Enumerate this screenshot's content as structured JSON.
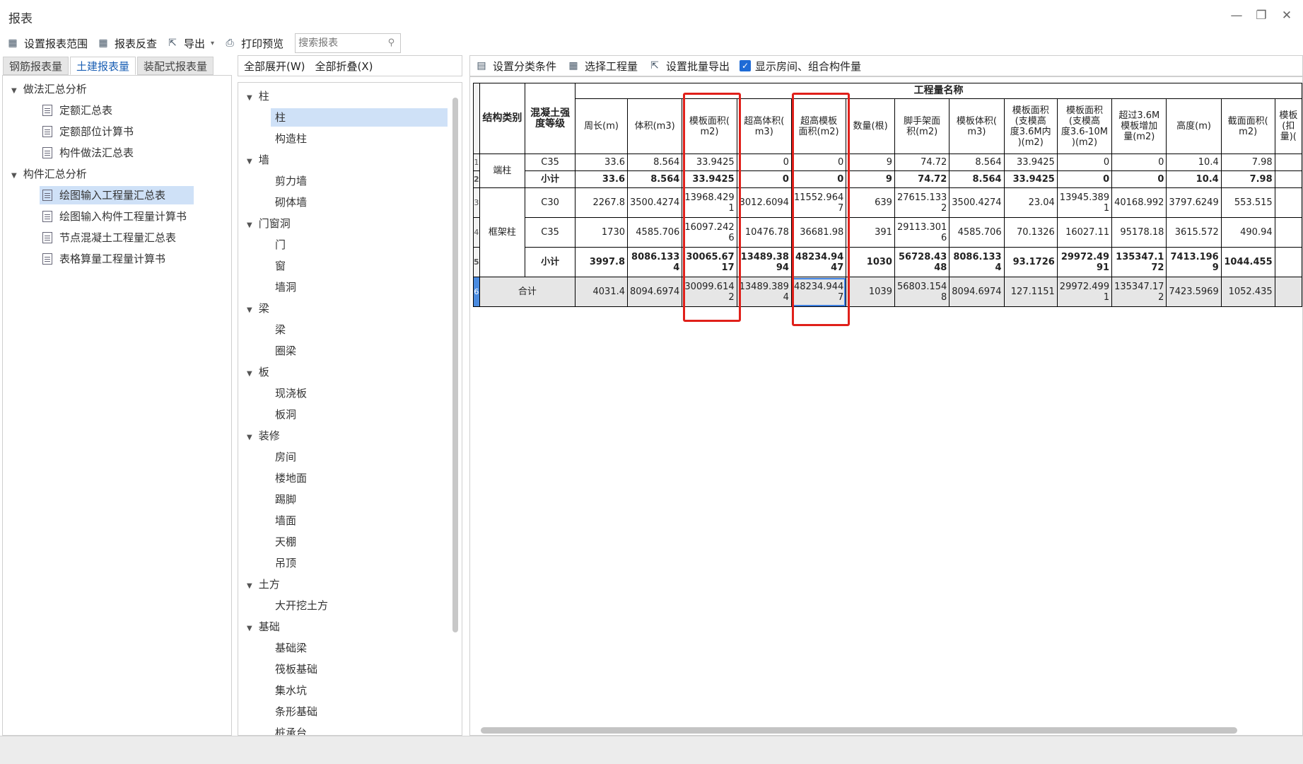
{
  "window": {
    "title": "报表"
  },
  "toolbar": {
    "set_range": "设置报表范围",
    "review": "报表反查",
    "export": "导出",
    "print_preview": "打印预览",
    "search_placeholder": "搜索报表"
  },
  "tabs": [
    "钢筋报表量",
    "土建报表量",
    "装配式报表量"
  ],
  "left_tree": {
    "group1": "做法汇总分析",
    "group1_items": [
      "定额汇总表",
      "定额部位计算书",
      "构件做法汇总表"
    ],
    "group2": "构件汇总分析",
    "group2_items": [
      "绘图输入工程量汇总表",
      "绘图输入构件工程量计算书",
      "节点混凝土工程量汇总表",
      "表格算量工程量计算书"
    ]
  },
  "middle": {
    "expand_all": "全部展开(W)",
    "collapse_all": "全部折叠(X)",
    "categories": [
      {
        "name": "柱",
        "items": [
          "柱",
          "构造柱"
        ]
      },
      {
        "name": "墙",
        "items": [
          "剪力墙",
          "砌体墙"
        ]
      },
      {
        "name": "门窗洞",
        "items": [
          "门",
          "窗",
          "墙洞"
        ]
      },
      {
        "name": "梁",
        "items": [
          "梁",
          "圈梁"
        ]
      },
      {
        "name": "板",
        "items": [
          "现浇板",
          "板洞"
        ]
      },
      {
        "name": "装修",
        "items": [
          "房间",
          "楼地面",
          "踢脚",
          "墙面",
          "天棚",
          "吊顶"
        ]
      },
      {
        "name": "土方",
        "items": [
          "大开挖土方"
        ]
      },
      {
        "name": "基础",
        "items": [
          "基础梁",
          "筏板基础",
          "集水坑",
          "条形基础",
          "桩承台"
        ]
      }
    ]
  },
  "right_toolbar": {
    "classify": "设置分类条件",
    "select_qty": "选择工程量",
    "batch_export": "设置批量导出",
    "show_rooms": "显示房间、组合构件量"
  },
  "table": {
    "group_header": "工程量名称",
    "col_struct": "结构类别",
    "col_grade": "混凝土强\n度等级",
    "columns": [
      "周长(m)",
      "体积(m3)",
      "模板面积(\nm2)",
      "超高体积(\nm3)",
      "超高模板\n面积(m2)",
      "数量(根)",
      "脚手架面\n积(m2)",
      "模板体积(\nm3)",
      "模板面积\n(支模高\n度3.6M内\n)(m2)",
      "模板面积\n(支模高\n度3.6-10M\n)(m2)",
      "超过3.6M\n模板增加\n量(m2)",
      "高度(m)",
      "截面面积(\nm2)",
      "模板\n(扣\n量)("
    ],
    "row_numbers": [
      "1",
      "2",
      "3",
      "4",
      "5",
      "6"
    ],
    "struct_labels": [
      "端柱",
      "框架柱",
      "合计"
    ],
    "rows": [
      {
        "grade": "C35",
        "values": [
          "33.6",
          "8.564",
          "33.9425",
          "0",
          "0",
          "9",
          "74.72",
          "8.564",
          "33.9425",
          "0",
          "0",
          "10.4",
          "7.98",
          ""
        ]
      },
      {
        "grade": "小计",
        "values": [
          "33.6",
          "8.564",
          "33.9425",
          "0",
          "0",
          "9",
          "74.72",
          "8.564",
          "33.9425",
          "0",
          "0",
          "10.4",
          "7.98",
          ""
        ]
      },
      {
        "grade": "C30",
        "values": [
          "2267.8",
          "3500.4274",
          "13968.429\n1",
          "3012.6094",
          "11552.964\n7",
          "639",
          "27615.133\n2",
          "3500.4274",
          "23.04",
          "13945.389\n1",
          "40168.992",
          "3797.6249",
          "553.515",
          ""
        ]
      },
      {
        "grade": "C35",
        "values": [
          "1730",
          "4585.706",
          "16097.242\n6",
          "10476.78",
          "36681.98",
          "391",
          "29113.301\n6",
          "4585.706",
          "70.1326",
          "16027.11",
          "95178.18",
          "3615.572",
          "490.94",
          ""
        ]
      },
      {
        "grade": "小计",
        "values": [
          "3997.8",
          "8086.133\n4",
          "30065.67\n17",
          "13489.38\n94",
          "48234.94\n47",
          "1030",
          "56728.43\n48",
          "8086.133\n4",
          "93.1726",
          "29972.49\n91",
          "135347.1\n72",
          "7413.196\n9",
          "1044.455",
          ""
        ]
      },
      {
        "grade": "",
        "values": [
          "4031.4",
          "8094.6974",
          "30099.614\n2",
          "13489.389\n4",
          "48234.944\n7",
          "1039",
          "56803.154\n8",
          "8094.6974",
          "127.1151",
          "29972.499\n1",
          "135347.17\n2",
          "7423.5969",
          "1052.435",
          ""
        ]
      }
    ]
  },
  "colors": {
    "highlight_box": "#e0201a",
    "selection": "#cfe1f7",
    "accent": "#1a5fb4"
  }
}
